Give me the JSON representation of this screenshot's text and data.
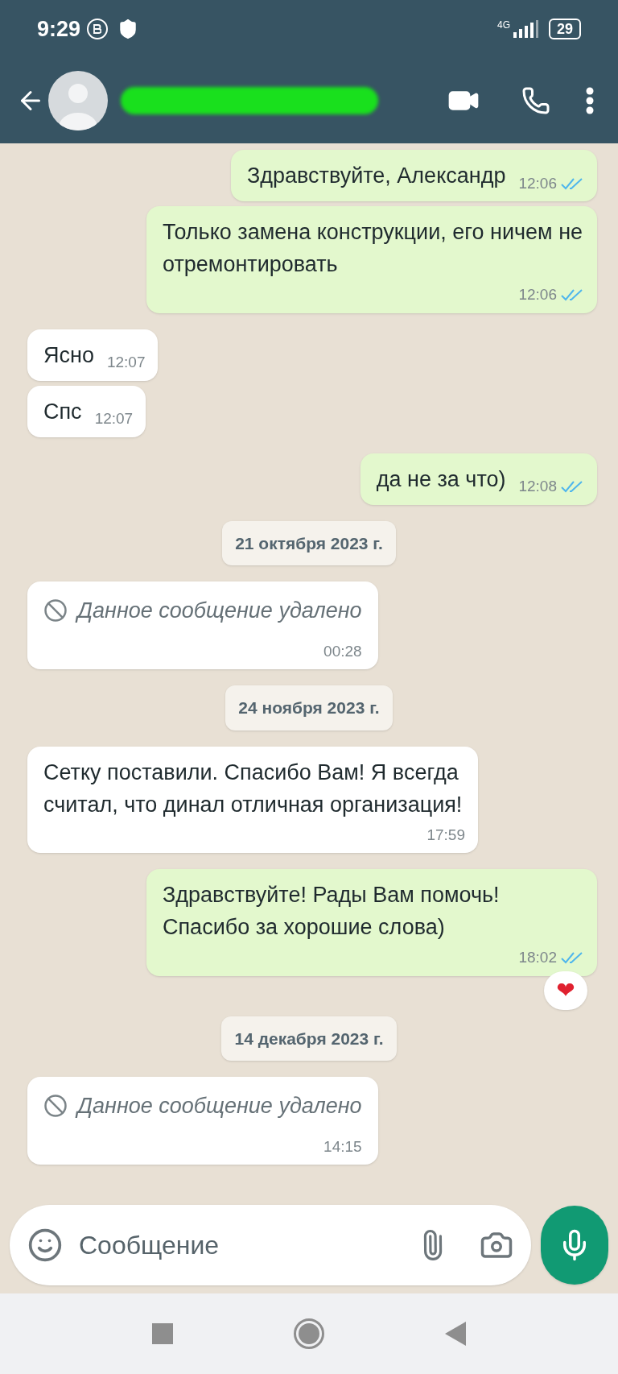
{
  "status_bar": {
    "time": "9:29",
    "network": "4G",
    "battery": "29"
  },
  "header": {
    "contact_redacted": true
  },
  "messages": [
    {
      "kind": "text",
      "outgoing": true,
      "text": "Здравствуйте, Александр",
      "time": "12:06",
      "read": true
    },
    {
      "kind": "text",
      "outgoing": true,
      "text": "Только замена конструкции, его ничем не отремонтировать",
      "time": "12:06",
      "read": true
    },
    {
      "kind": "text",
      "outgoing": false,
      "text": "Ясно",
      "time": "12:07"
    },
    {
      "kind": "text",
      "outgoing": false,
      "text": "Спс",
      "time": "12:07"
    },
    {
      "kind": "text",
      "outgoing": true,
      "text": "да не за что)",
      "time": "12:08",
      "read": true
    },
    {
      "kind": "date",
      "text": "21 октября 2023 г."
    },
    {
      "kind": "deleted",
      "outgoing": false,
      "text": "Данное сообщение удалено",
      "time": "00:28"
    },
    {
      "kind": "date",
      "text": "24 ноября 2023 г."
    },
    {
      "kind": "text",
      "outgoing": false,
      "text": "Сетку поставили. Спасибо Вам! Я всегда считал, что динал отличная организация!",
      "time": "17:59"
    },
    {
      "kind": "text",
      "outgoing": true,
      "text": "Здравствуйте! Рады Вам помочь! Спасибо за хорошие слова)",
      "time": "18:02",
      "read": true,
      "reaction": "❤"
    },
    {
      "kind": "date",
      "text": "14 декабря 2023 г."
    },
    {
      "kind": "deleted",
      "outgoing": false,
      "text": "Данное сообщение удалено",
      "time": "14:15"
    }
  ],
  "composer": {
    "placeholder": "Сообщение"
  }
}
